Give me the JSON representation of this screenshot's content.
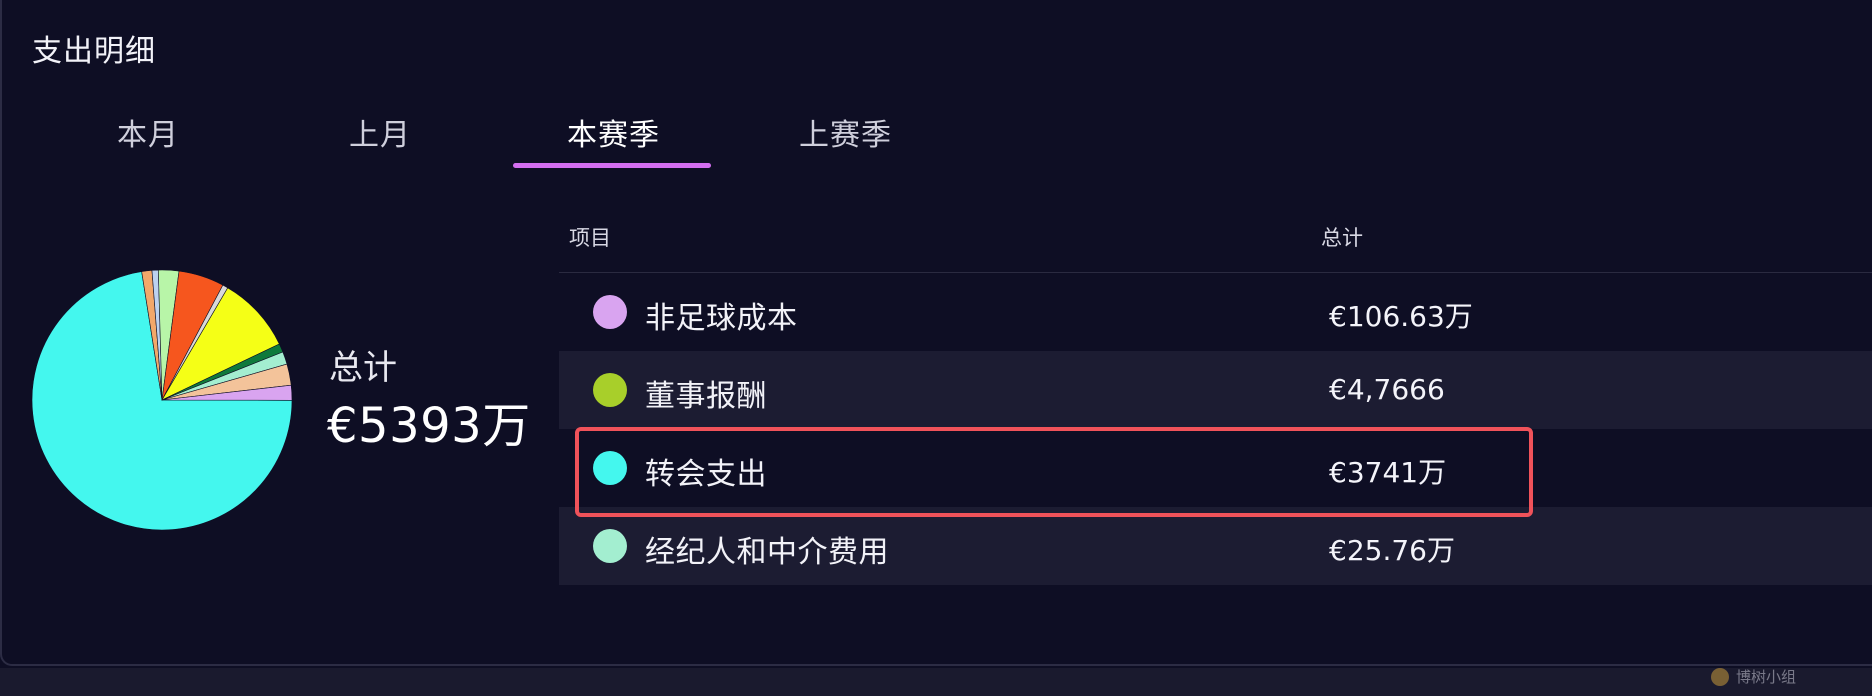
{
  "panel": {
    "title": "支出明细"
  },
  "tabs": [
    {
      "label": "本月",
      "active": false
    },
    {
      "label": "上月",
      "active": false
    },
    {
      "label": "本赛季",
      "active": true
    },
    {
      "label": "上赛季",
      "active": false
    }
  ],
  "summary": {
    "total_label": "总计",
    "total_value": "€5393万"
  },
  "table": {
    "headers": {
      "item": "项目",
      "total": "总计"
    },
    "rows": [
      {
        "label": "非足球成本",
        "value": "€106.63万",
        "color": "#d9a4f0"
      },
      {
        "label": "董事报酬",
        "value": "€4,7666",
        "color": "#a8cf2a"
      },
      {
        "label": "转会支出",
        "value": "€3741万",
        "color": "#44f7ee"
      },
      {
        "label": "经纪人和中介费用",
        "value": "€25.76万",
        "color": "#a3eed0"
      }
    ]
  },
  "chart_data": {
    "type": "pie",
    "slices": [
      {
        "value": 74.2,
        "color": "#44f7ee"
      },
      {
        "value": 1.3,
        "color": "#f2a86a"
      },
      {
        "value": 0.8,
        "color": "#bcd2f0"
      },
      {
        "value": 2.6,
        "color": "#b8f5a8"
      },
      {
        "value": 5.8,
        "color": "#f6561e"
      },
      {
        "value": 0.7,
        "color": "#d9d9d9"
      },
      {
        "value": 9.7,
        "color": "#f5ff16"
      },
      {
        "value": 1.1,
        "color": "#0e7a3c"
      },
      {
        "value": 1.6,
        "color": "#a3eed0"
      },
      {
        "value": 2.7,
        "color": "#f3c39a"
      },
      {
        "value": 1.9,
        "color": "#d9a4f0"
      }
    ]
  },
  "watermark": {
    "text": "博树小组"
  }
}
